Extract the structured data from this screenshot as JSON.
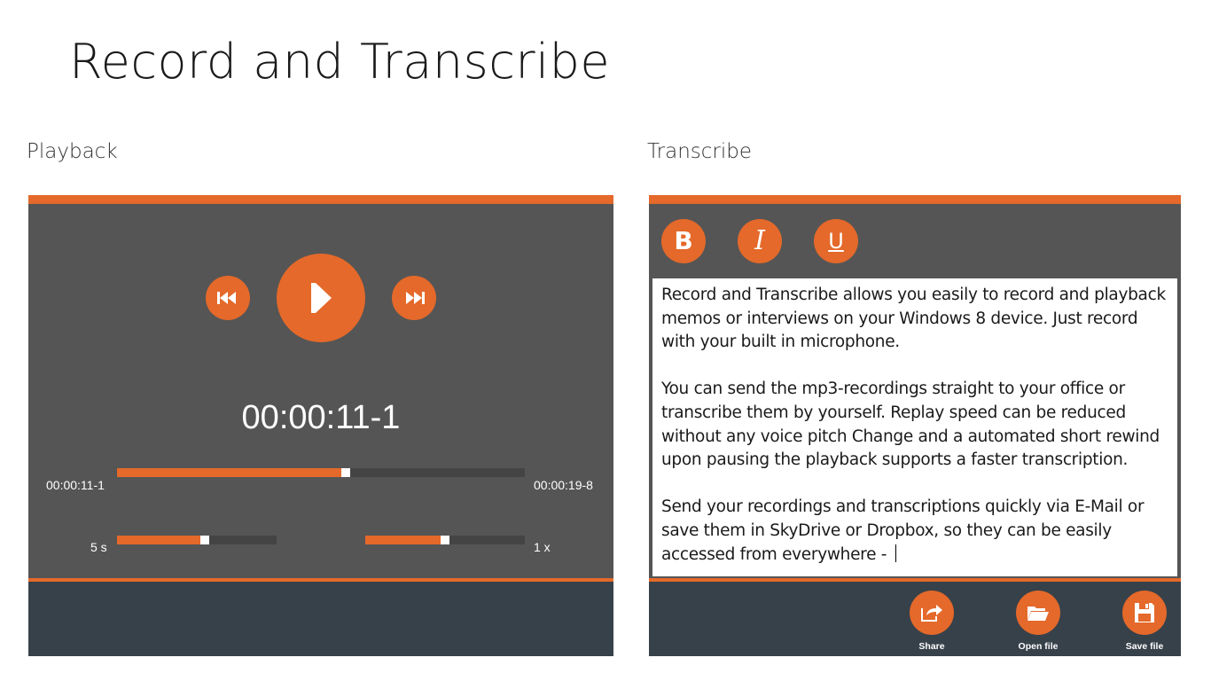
{
  "app": {
    "title": "Record and Transcribe"
  },
  "playback": {
    "heading": "Playback",
    "current_time": "00:00:11-1",
    "elapsed_label": "00:00:11-1",
    "total_label": "00:00:19-8",
    "progress_fraction": 0.56,
    "rewind_label": "5 s",
    "rewind_fraction": 0.55,
    "speed_label": "1 x",
    "speed_fraction": 0.5
  },
  "transcribe": {
    "heading": "Transcribe",
    "format_buttons": [
      "bold-icon",
      "italic-icon",
      "underline-icon"
    ],
    "text": "Record and Transcribe allows you easily to record and playback memos or interviews on your Windows 8 device. Just record with your built in microphone.\n\nYou can send the mp3-recordings straight to your office or transcribe them by yourself. Replay speed can be reduced without any voice pitch Change and a automated short rewind upon pausing the playback supports a faster transcription.\n\nSend your recordings and transcriptions quickly via E-Mail or save them in SkyDrive or Dropbox, so they can be easily accessed from everywhere - ",
    "actions": {
      "share": "Share",
      "open": "Open file",
      "save": "Save file"
    }
  },
  "colors": {
    "accent": "#e4692a",
    "panel": "#555555",
    "footer": "#37414a"
  }
}
